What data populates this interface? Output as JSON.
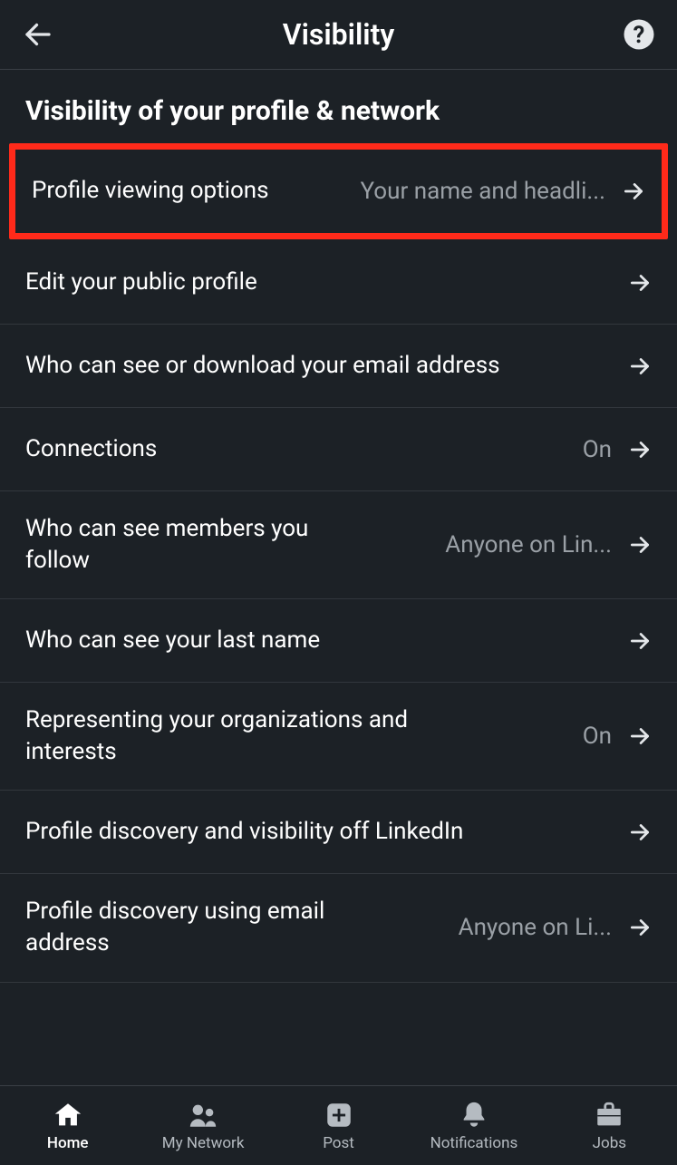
{
  "header": {
    "title": "Visibility"
  },
  "section": {
    "title": "Visibility of your profile & network"
  },
  "items": [
    {
      "label": "Profile viewing options",
      "value": "Your name and headli..."
    },
    {
      "label": "Edit your public profile",
      "value": ""
    },
    {
      "label": "Who can see or download your email address",
      "value": ""
    },
    {
      "label": "Connections",
      "value": "On"
    },
    {
      "label": "Who can see members you follow",
      "value": "Anyone on Lin..."
    },
    {
      "label": "Who can see your last name",
      "value": ""
    },
    {
      "label": "Representing your organizations and interests",
      "value": "On"
    },
    {
      "label": "Profile discovery and visibility off LinkedIn",
      "value": ""
    },
    {
      "label": "Profile discovery using email address",
      "value": "Anyone on Li..."
    }
  ],
  "nav": {
    "home": "Home",
    "network": "My Network",
    "post": "Post",
    "notifications": "Notifications",
    "jobs": "Jobs"
  }
}
